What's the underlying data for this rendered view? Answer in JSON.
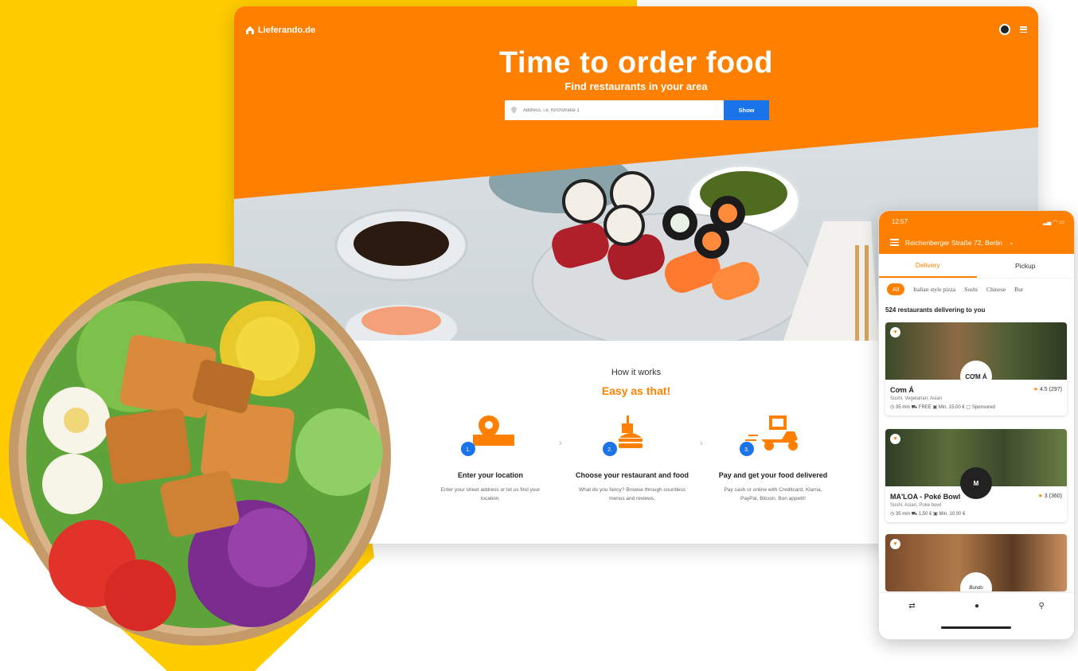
{
  "colors": {
    "brand_orange": "#FF8000",
    "yellow": "#FFCC00",
    "show_blue": "#1A73E8"
  },
  "desktop": {
    "logo_text": "Lieferando.de",
    "hero_title": "Time to order food",
    "hero_subtitle": "Find restaurants in your area",
    "search": {
      "placeholder": "Address, i.e. Kirchstraße 1",
      "button_label": "Show"
    },
    "how": {
      "label": "How it works",
      "title": "Easy as that!",
      "steps": [
        {
          "number": "1.",
          "icon": "location-pin-icon",
          "title": "Enter your location",
          "desc_1": "Enter your street address or let us find your",
          "desc_2": "location."
        },
        {
          "number": "2.",
          "icon": "burger-drink-icon",
          "title": "Choose your restaurant and food",
          "desc_1": "What do you fancy? Browse through countless",
          "desc_2": "menus and reviews."
        },
        {
          "number": "3.",
          "icon": "delivery-scooter-icon",
          "title": "Pay and get your food delivered",
          "desc_1": "Pay cash or online with Creditcard, Klarna,",
          "desc_2": "PayPal, Bitcoin. Bon appetit!"
        }
      ],
      "chevron": "›"
    }
  },
  "phone": {
    "time": "12:57",
    "status_icons": "▂▄ ◠ ▭",
    "address": "Reichenberger Straße 72, Berlin",
    "address_chevron": "⌄",
    "tabs": [
      "Delivery",
      "Pickup"
    ],
    "categories": [
      "All",
      "Italian style pizza",
      "Sushi",
      "Chinese",
      "Bur"
    ],
    "count_text": "524 restaurants delivering to you",
    "restaurants": [
      {
        "name": "Cơm Á",
        "logo_text": "CƠM Á",
        "rating": "4.5",
        "reviews": "(297)",
        "tags": "Sushi, Vegetarian, Asian",
        "meta": "◷ 35 min  ⛟ FREE  ▣ Min. 15,00 €  ▢ Sponsored"
      },
      {
        "name": "MA'LOA - Poké Bowl",
        "logo_text": "M",
        "rating": "3",
        "reviews": "(360)",
        "tags": "Sushi, Asian, Poke bowl",
        "meta": "◷ 35 min  ⛟ 1,50 €  ▣ Min. 10,00 €"
      },
      {
        "name": "",
        "logo_text": "Bundo",
        "rating": "",
        "reviews": "",
        "tags": "",
        "meta": ""
      }
    ],
    "nav_icons": [
      "⇄",
      "●",
      "⚲"
    ]
  }
}
